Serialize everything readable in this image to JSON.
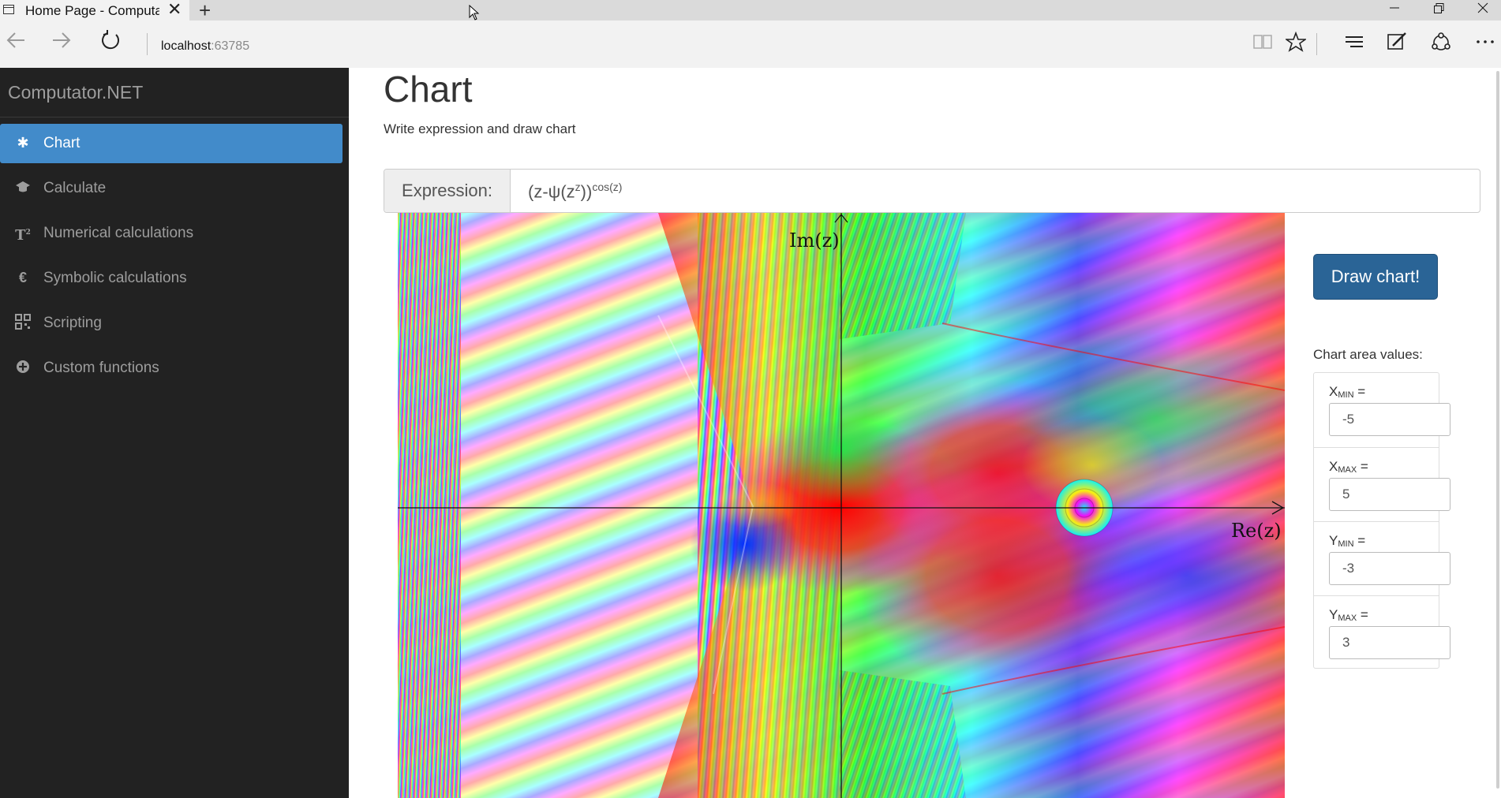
{
  "browser": {
    "tab_title": "Home Page - Computat",
    "close_tab_glyph": "✕",
    "new_tab_glyph": "+",
    "url_host": "localhost",
    "url_port": ":63785"
  },
  "sidebar": {
    "brand": "Computator.NET",
    "items": [
      {
        "label": "Chart",
        "icon": "asterisk-icon",
        "active": true
      },
      {
        "label": "Calculate",
        "icon": "graduation-cap-icon",
        "active": false
      },
      {
        "label": "Numerical calculations",
        "icon": "superscript-t-icon",
        "active": false
      },
      {
        "label": "Symbolic calculations",
        "icon": "euro-icon",
        "active": false
      },
      {
        "label": "Scripting",
        "icon": "qrcode-icon",
        "active": false
      },
      {
        "label": "Custom functions",
        "icon": "plus-circle-icon",
        "active": false
      }
    ]
  },
  "main": {
    "title": "Chart",
    "subtitle": "Write expression and draw chart",
    "expression_label": "Expression:",
    "expression_base": "(z-ψ(z",
    "expression_inner_sup": "z",
    "expression_close": "))",
    "expression_outer_sup": "cos(z)",
    "draw_button": "Draw chart!",
    "area_title": "Chart area values:",
    "area": {
      "xmin_var": "X",
      "xmin_sub": "MIN",
      "xmin": "-5",
      "xmax_var": "X",
      "xmax_sub": "MAX",
      "xmax": "5",
      "ymin_var": "Y",
      "ymin_sub": "MIN",
      "ymin": "-3",
      "ymax_var": "Y",
      "ymax_sub": "MAX",
      "ymax": "3",
      "equals": "="
    }
  },
  "plot": {
    "x_axis_label": "Re(z)",
    "y_axis_label": "Im(z)"
  },
  "colors": {
    "accent": "#428bca",
    "sidebar_bg": "#222222",
    "button_bg": "#2a6496"
  }
}
